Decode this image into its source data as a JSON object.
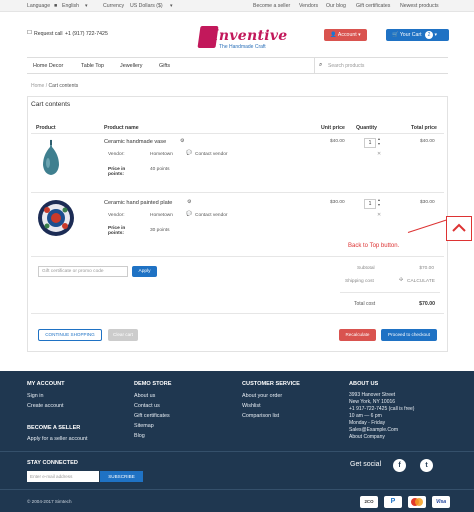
{
  "topbar": {
    "language_label": "Language",
    "language_value": "English",
    "currency_label": "Currency",
    "currency_value": "US Dollars ($)",
    "links": [
      "Become a seller",
      "Vendors",
      "Our blog",
      "Gift certificates",
      "Newest products"
    ]
  },
  "header": {
    "request_call": "Request call",
    "phone": "+1 (917) 722-7425",
    "logo_text": "Inventive",
    "logo_sub": "The Handmade Craft",
    "account_label": "Account",
    "cart_label": "Your Cart",
    "cart_count": "2"
  },
  "nav": {
    "items": [
      "Home Decor",
      "Table Top",
      "Jewellery",
      "Gifts"
    ],
    "search_placeholder": "Search products"
  },
  "breadcrumb": {
    "home": "Home",
    "current": "Cart contents"
  },
  "cart": {
    "title": "Cart contents",
    "columns": {
      "product": "Product",
      "product_name": "Product name",
      "unit_price": "Unit price",
      "quantity": "Quantity",
      "total_price": "Total price"
    },
    "items": [
      {
        "name": "Ceramic handmade vase",
        "vendor_label": "Vendor:",
        "vendor": "Hometown",
        "contact": "Contact vendor",
        "points_label": "Price in points:",
        "points": "40 points",
        "unit_price": "$40.00",
        "qty": "1",
        "total": "$40.00"
      },
      {
        "name": "Ceramic hand painted plate",
        "vendor_label": "Vendor:",
        "vendor": "Hometown",
        "contact": "Contact vendor",
        "points_label": "Price in points:",
        "points": "30 points",
        "unit_price": "$30.00",
        "qty": "1",
        "total": "$30.00"
      }
    ],
    "promo_placeholder": "Gift certificate or promo code",
    "apply_label": "Apply",
    "subtotal_label": "Subtotal",
    "subtotal_value": "$70.00",
    "shipping_label": "Shipping cost",
    "calculate_label": "CALCULATE",
    "total_label": "Total cost",
    "total_value": "$70.00",
    "continue_label": "CONTINUE SHOPPING",
    "clear_label": "Clear cart",
    "recalc_label": "Recalculate",
    "checkout_label": "Proceed to checkout",
    "annotation": "Back to Top button."
  },
  "footer": {
    "my_account": {
      "title": "MY ACCOUNT",
      "items": [
        "Sign in",
        "Create account"
      ]
    },
    "seller": {
      "title": "BECOME A SELLER",
      "items": [
        "Apply for a seller account"
      ]
    },
    "demo_store": {
      "title": "DEMO STORE",
      "items": [
        "About us",
        "Contact us",
        "Gift certificates",
        "Sitemap",
        "Blog"
      ]
    },
    "customer_service": {
      "title": "CUSTOMER SERVICE",
      "items": [
        "About your order",
        "Wishlist",
        "Comparison list"
      ]
    },
    "about": {
      "title": "ABOUT US",
      "items": [
        "3993 Hanover Street",
        "New York, NY 10016",
        "+1 917-722-7425 (call is free)",
        "10 am — 6 pm",
        "Monday - Friday",
        "Sales@Example.Com",
        "About Company"
      ]
    },
    "stay_connected": "STAY CONNECTED",
    "email_placeholder": "Enter e-mail address",
    "subscribe_label": "SUBSCRIBE",
    "get_social": "Get social",
    "copyright": "© 2004-2017 Simtech",
    "payments": [
      "2CO",
      "PayPal",
      "MasterCard",
      "Visa"
    ]
  }
}
